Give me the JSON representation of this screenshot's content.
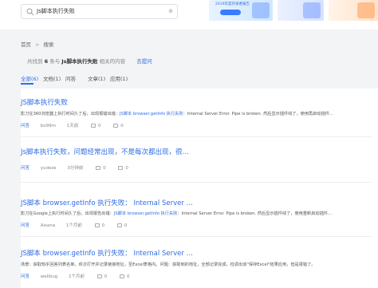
{
  "search": {
    "query": "Js脚本执行失败",
    "clear": "⊗"
  },
  "banners": [
    {
      "title": "2019年度开发者报告"
    },
    {
      "title": ""
    },
    {
      "title": ""
    }
  ],
  "breadcrumb": {
    "home": "首页",
    "current": "搜索"
  },
  "summary": {
    "prefix": "共找到",
    "count": "6",
    "middle": "条与",
    "query": "Js脚本执行失败",
    "suffix": "相关的内容",
    "feedback": "去提问"
  },
  "tabs": [
    "全部(6)",
    "文档(1)",
    "问答",
    "文章(1)",
    "应用(1)"
  ],
  "results": [
    {
      "title_pre": "",
      "title_hl": "JS脚本执行失败",
      "title_post": "",
      "snippet_pre": "影刀在360浏览器上执行时间久了后，出现报错出错：",
      "snippet_kw": "JS脚本 browser.getInfo 执行失败",
      "snippet_post": "：Internal Server Error. Pipe is broken. 然后显示插件线了，使用再启动插件…",
      "tag": "问答",
      "author": "bo99m",
      "time": "1天前",
      "views": "0",
      "comments": "0"
    },
    {
      "title_pre": "",
      "title_hl": "Js脚本执行失败",
      "title_post": "，问题经常出现，不是每次都出现，很…",
      "snippet_pre": "",
      "snippet_kw": "",
      "snippet_post": "",
      "tag": "问答",
      "author": "yudeze",
      "time": "3分钟前",
      "views": "0",
      "comments": "0"
    },
    {
      "title_pre": "",
      "title_hl": "JS脚本",
      "title_post": " browser.getInfo 执行失败：  Internal Server …",
      "snippet_pre": "影刀在Google上执行时间久了后，出现报告出错：",
      "snippet_kw": "JS脚本 browser.getInfo 执行失败",
      "snippet_post": "：Internal Server Error. Pipe is broken. 然后显示插件线了，使用重新启动插件…",
      "tag": "问答",
      "author": "Aisana",
      "time": "1个月前",
      "views": "0",
      "comments": "0"
    },
    {
      "title_pre": "",
      "title_hl": "JS脚本",
      "title_post": " browser.getInfo 执行失败：  Internal Server …",
      "snippet_pre": "场景：获取知乎回答列表名单。依次打开并记录链接地址，至Excel表格内。问题：获取到的地址，全部记录完成，检调出该\"保存Excel\"结果应用，但是报错了。",
      "snippet_kw": "",
      "snippet_post": "",
      "tag": "问答",
      "author": "wellbug",
      "time": "1个月前",
      "views": "0",
      "comments": "0"
    }
  ]
}
